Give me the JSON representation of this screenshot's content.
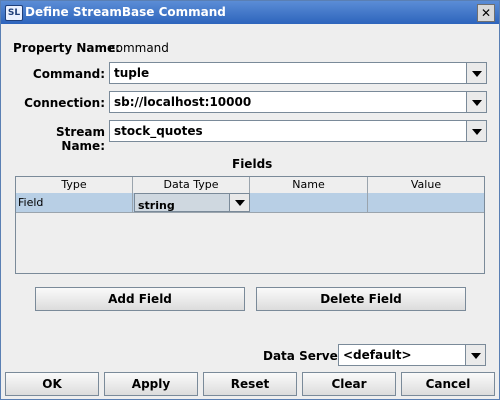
{
  "window": {
    "title": "Define StreamBase Command",
    "app_icon_text": "SL",
    "close_glyph": "✕"
  },
  "form": {
    "property_name_label": "Property Name:",
    "property_name_value": "command",
    "command_label": "Command:",
    "command_value": "tuple",
    "connection_label": "Connection:",
    "connection_value": "sb://localhost:10000",
    "stream_name_label": "Stream Name:",
    "stream_name_value": "stock_quotes"
  },
  "fields": {
    "section_title": "Fields",
    "columns": [
      "Type",
      "Data Type",
      "Name",
      "Value"
    ],
    "rows": [
      {
        "type": "Field",
        "data_type": "string",
        "name": "",
        "value": ""
      }
    ]
  },
  "buttons": {
    "add_field": "Add Field",
    "delete_field": "Delete Field",
    "ok": "OK",
    "apply": "Apply",
    "reset": "Reset",
    "clear": "Clear",
    "cancel": "Cancel"
  },
  "data_server": {
    "label": "Data Server:",
    "value": "<default>"
  }
}
